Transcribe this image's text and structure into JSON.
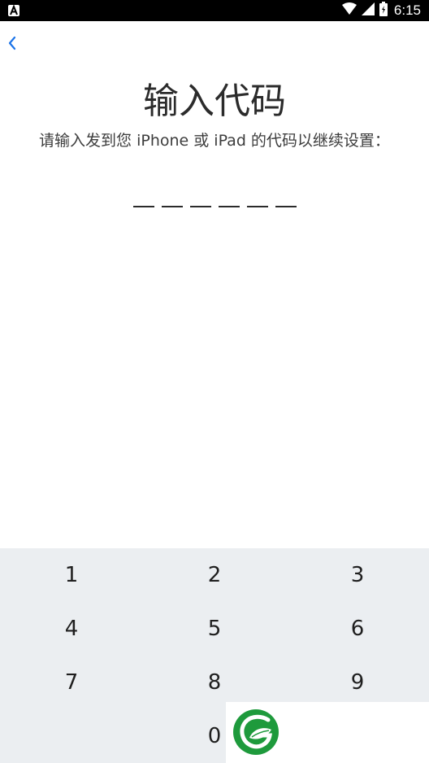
{
  "status_bar": {
    "time": "6:15",
    "left_icon": "notification-a-icon",
    "right_icons": [
      "wifi-icon",
      "cell-signal-icon",
      "battery-icon"
    ]
  },
  "nav": {
    "back_icon": "chevron-left-icon",
    "accent_color": "#1a73e8"
  },
  "title": "输入代码",
  "subtitle": "请输入发到您 iPhone 或 iPad 的代码以继续设置：",
  "code": {
    "length": 6,
    "entered": ""
  },
  "keypad": {
    "rows": [
      [
        "1",
        "2",
        "3"
      ],
      [
        "4",
        "5",
        "6"
      ],
      [
        "7",
        "8",
        "9"
      ],
      [
        "",
        "0",
        ""
      ]
    ]
  },
  "watermark": {
    "icon": "green-leaf-logo",
    "color": "#1e9a3c"
  }
}
